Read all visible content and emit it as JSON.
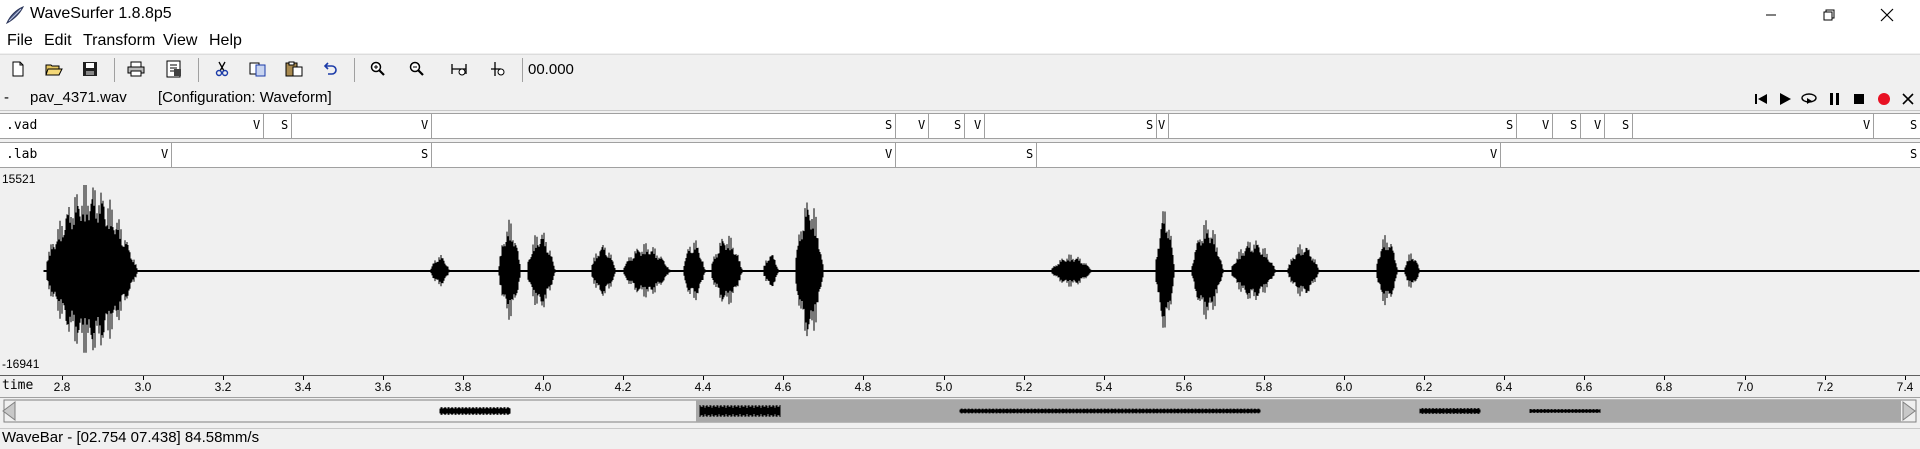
{
  "window": {
    "title": "WaveSurfer 1.8.8p5"
  },
  "menu": {
    "items": [
      "File",
      "Edit",
      "Transform",
      "View",
      "Help"
    ]
  },
  "toolbar": {
    "time_display": "00.000",
    "buttons": [
      "new-file-icon",
      "open-folder-icon",
      "save-icon",
      "print-icon",
      "properties-icon",
      "cut-icon",
      "copy-icon",
      "paste-icon",
      "undo-icon",
      "zoom-in-icon",
      "zoom-out-icon",
      "zoom-fit-icon",
      "zoom-selection-icon"
    ]
  },
  "file_row": {
    "dash": "-",
    "file_name": "pav_4371.wav",
    "configuration": "[Configuration: Waveform]"
  },
  "tiers": [
    {
      "name": ".vad",
      "labels": [
        {
          "t": 2.754,
          "text": "V"
        },
        {
          "t": 3.3,
          "text": "S"
        },
        {
          "t": 3.37,
          "text": "V"
        },
        {
          "t": 3.72,
          "text": "S"
        },
        {
          "t": 4.88,
          "text": "V"
        },
        {
          "t": 4.96,
          "text": "S"
        },
        {
          "t": 5.05,
          "text": "V"
        },
        {
          "t": 5.1,
          "text": "S"
        },
        {
          "t": 5.53,
          "text": "V"
        },
        {
          "t": 5.56,
          "text": "S"
        },
        {
          "t": 6.43,
          "text": "V"
        },
        {
          "t": 6.52,
          "text": "S"
        },
        {
          "t": 6.59,
          "text": "V"
        },
        {
          "t": 6.65,
          "text": "S"
        },
        {
          "t": 6.72,
          "text": "V"
        },
        {
          "t": 7.32,
          "text": "S"
        },
        {
          "t": 7.438,
          "text": ""
        }
      ],
      "dividers": [
        3.3,
        3.37,
        3.72,
        4.88,
        4.96,
        5.05,
        5.1,
        5.53,
        5.56,
        6.43,
        6.52,
        6.59,
        6.65,
        6.72,
        7.32
      ]
    },
    {
      "name": ".lab",
      "labels": [
        {
          "t": 2.754,
          "text": "V"
        },
        {
          "t": 3.07,
          "text": "S"
        },
        {
          "t": 3.72,
          "text": "V"
        },
        {
          "t": 4.88,
          "text": "S"
        },
        {
          "t": 5.23,
          "text": "V"
        },
        {
          "t": 6.39,
          "text": "S"
        },
        {
          "t": 7.438,
          "text": ""
        }
      ],
      "dividers": [
        3.07,
        3.72,
        4.88,
        5.23,
        6.39
      ]
    }
  ],
  "waveform": {
    "ymax": "15521",
    "ymin": "-16941"
  },
  "axis": {
    "name": "time",
    "start": 2.754,
    "end": 7.438,
    "ticks": [
      "2.8",
      "3.0",
      "3.2",
      "3.4",
      "3.6",
      "3.8",
      "4.0",
      "4.2",
      "4.4",
      "4.6",
      "4.8",
      "5.0",
      "5.2",
      "5.4",
      "5.6",
      "5.8",
      "6.0",
      "6.2",
      "6.4",
      "6.6",
      "6.8",
      "7.0",
      "7.2",
      "7.4"
    ]
  },
  "playback": {
    "buttons": [
      "skip-start-icon",
      "play-icon",
      "loop-play-icon",
      "pause-icon",
      "stop-icon",
      "record-icon",
      "close-icon"
    ],
    "record_color": "#e81123"
  },
  "status": {
    "text": "WaveBar - [02.754 07.438] 84.58mm/s"
  }
}
